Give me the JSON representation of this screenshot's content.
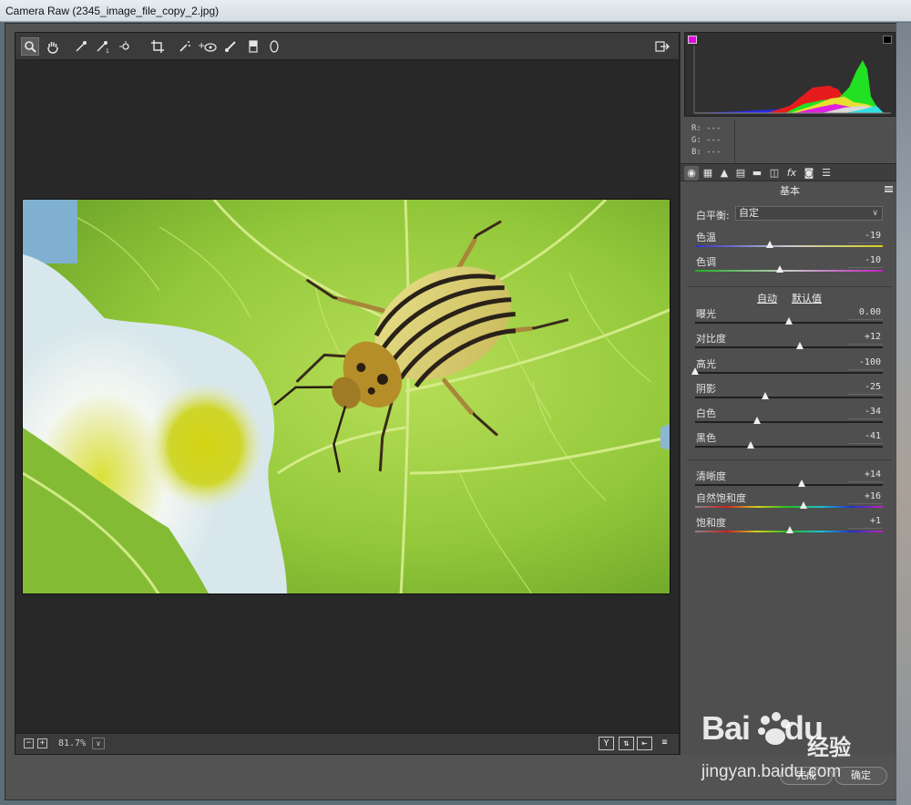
{
  "window": {
    "title": "Camera Raw (2345_image_file_copy_2.jpg)"
  },
  "toolbar": {
    "tools": [
      {
        "name": "zoom-tool-icon",
        "glyph": "🔍︎"
      },
      {
        "name": "hand-tool-icon",
        "glyph": "✋︎"
      },
      {
        "name": "white-balance-tool-icon",
        "glyph": "⁄"
      },
      {
        "name": "color-sampler-tool-icon",
        "glyph": "⁄"
      },
      {
        "name": "targeted-adjustment-tool-icon",
        "glyph": "⊙"
      },
      {
        "name": "crop-tool-icon",
        "glyph": "⌗"
      },
      {
        "name": "spot-removal-tool-icon",
        "glyph": "⁄"
      },
      {
        "name": "red-eye-tool-icon",
        "glyph": "+◉"
      },
      {
        "name": "adjustment-brush-icon",
        "glyph": "⁄"
      },
      {
        "name": "graduated-filter-icon",
        "glyph": "▮"
      },
      {
        "name": "radial-filter-icon",
        "glyph": "○"
      }
    ],
    "open_in_photoshop_glyph": "⇥"
  },
  "statusbar": {
    "zoom_out": "−",
    "zoom_in": "+",
    "zoom_value": "81.7%",
    "zoom_dropdown": "∨",
    "view_before_after": "Y",
    "swap": "⇅",
    "copy": "⇤",
    "prefs": "≡"
  },
  "histogram": {
    "r": "R:  ---",
    "g": "G:  ---",
    "b": "B:  ---"
  },
  "panel_tabs": [
    {
      "name": "tab-basic-icon",
      "glyph": "◉"
    },
    {
      "name": "tab-tone-curve-icon",
      "glyph": "▦"
    },
    {
      "name": "tab-detail-icon",
      "glyph": "▲"
    },
    {
      "name": "tab-hsl-icon",
      "glyph": "▤"
    },
    {
      "name": "tab-split-toning-icon",
      "glyph": "▬"
    },
    {
      "name": "tab-lens-icon",
      "glyph": "◫"
    },
    {
      "name": "tab-effects-icon",
      "glyph": "fx"
    },
    {
      "name": "tab-camera-calibration-icon",
      "glyph": "◙"
    },
    {
      "name": "tab-presets-icon",
      "glyph": "☰"
    }
  ],
  "basic": {
    "section_title": "基本",
    "white_balance_label": "白平衡:",
    "white_balance_value": "自定",
    "auto_label": "自动",
    "default_label": "默认值",
    "sliders": [
      {
        "key": "temperature",
        "label": "色温",
        "value": "-19",
        "pos": 0.4,
        "track": "temp"
      },
      {
        "key": "tint",
        "label": "色调",
        "value": "-10",
        "pos": 0.45,
        "track": "tint"
      },
      {
        "key": "exposure",
        "label": "曝光",
        "value": "0.00",
        "pos": 0.5,
        "track": "plain"
      },
      {
        "key": "contrast",
        "label": "对比度",
        "value": "+12",
        "pos": 0.56,
        "track": "plain"
      },
      {
        "key": "highlights",
        "label": "高光",
        "value": "-100",
        "pos": 0.0,
        "track": "plain"
      },
      {
        "key": "shadows",
        "label": "阴影",
        "value": "-25",
        "pos": 0.375,
        "track": "plain"
      },
      {
        "key": "whites",
        "label": "白色",
        "value": "-34",
        "pos": 0.33,
        "track": "plain"
      },
      {
        "key": "blacks",
        "label": "黑色",
        "value": "-41",
        "pos": 0.295,
        "track": "plain"
      },
      {
        "key": "clarity",
        "label": "清晰度",
        "value": "+14",
        "pos": 0.57,
        "track": "plain"
      },
      {
        "key": "vibrance",
        "label": "自然饱和度",
        "value": "+16",
        "pos": 0.58,
        "track": "sat"
      },
      {
        "key": "saturation",
        "label": "饱和度",
        "value": "+1",
        "pos": 0.505,
        "track": "sat"
      }
    ]
  },
  "buttons": {
    "done": "完成",
    "ok": "确定"
  },
  "watermark": {
    "brand": "Bai",
    "brand2": "du",
    "cn": "经验",
    "url": "jingyan.baidu.com"
  }
}
